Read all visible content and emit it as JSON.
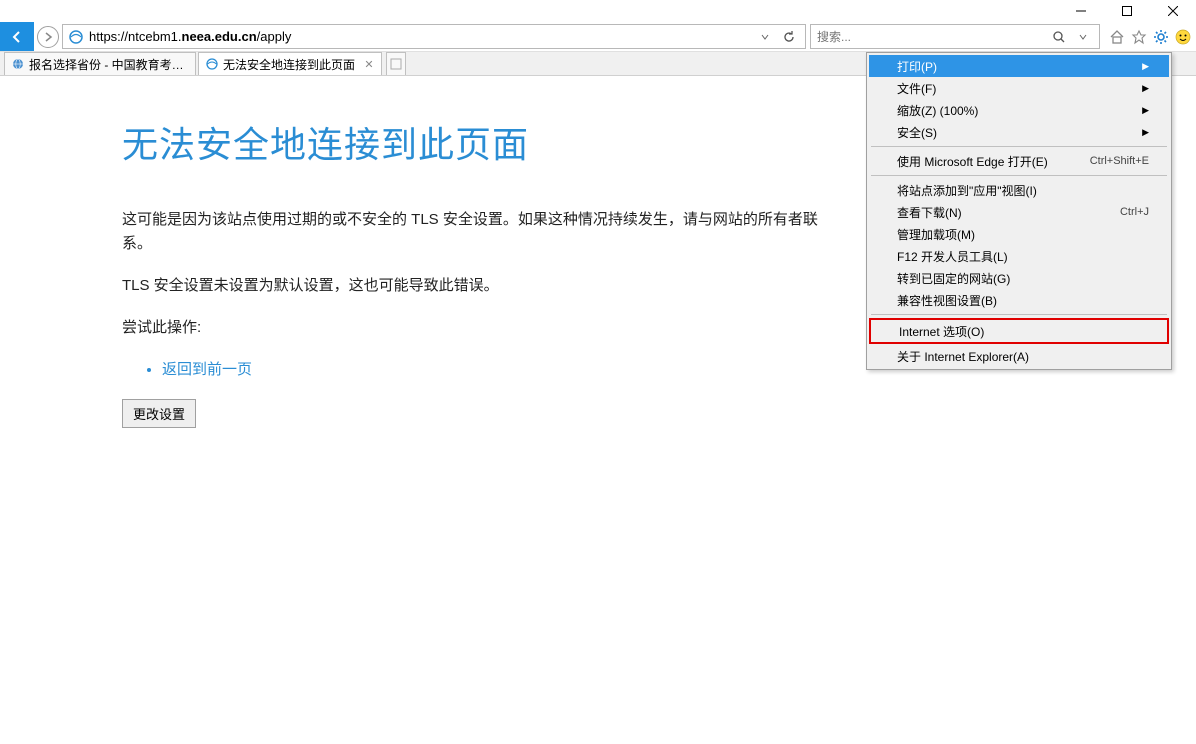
{
  "address": {
    "prefix": "https://ntcebm1.",
    "domain": "neea.edu.cn",
    "suffix": "/apply"
  },
  "search": {
    "placeholder": "搜索..."
  },
  "tabs": [
    {
      "title": "报名选择省份 - 中国教育考试网",
      "active": false
    },
    {
      "title": "无法安全地连接到此页面",
      "active": true
    }
  ],
  "page": {
    "heading": "无法安全地连接到此页面",
    "para1": "这可能是因为该站点使用过期的或不安全的 TLS 安全设置。如果这种情况持续发生，请与网站的所有者联系。",
    "para2": "TLS 安全设置未设置为默认设置，这也可能导致此错误。",
    "try_label": "尝试此操作:",
    "back_link": "返回到前一页",
    "change_settings": "更改设置"
  },
  "menu": {
    "print": "打印(P)",
    "file": "文件(F)",
    "zoom": "缩放(Z) (100%)",
    "safety": "安全(S)",
    "edge": "使用 Microsoft Edge 打开(E)",
    "edge_sc": "Ctrl+Shift+E",
    "addsite": "将站点添加到\"应用\"视图(I)",
    "downloads": "查看下载(N)",
    "downloads_sc": "Ctrl+J",
    "addons": "管理加载项(M)",
    "f12": "F12 开发人员工具(L)",
    "pinned": "转到已固定的网站(G)",
    "compat": "兼容性视图设置(B)",
    "options": "Internet 选项(O)",
    "about": "关于 Internet Explorer(A)"
  }
}
